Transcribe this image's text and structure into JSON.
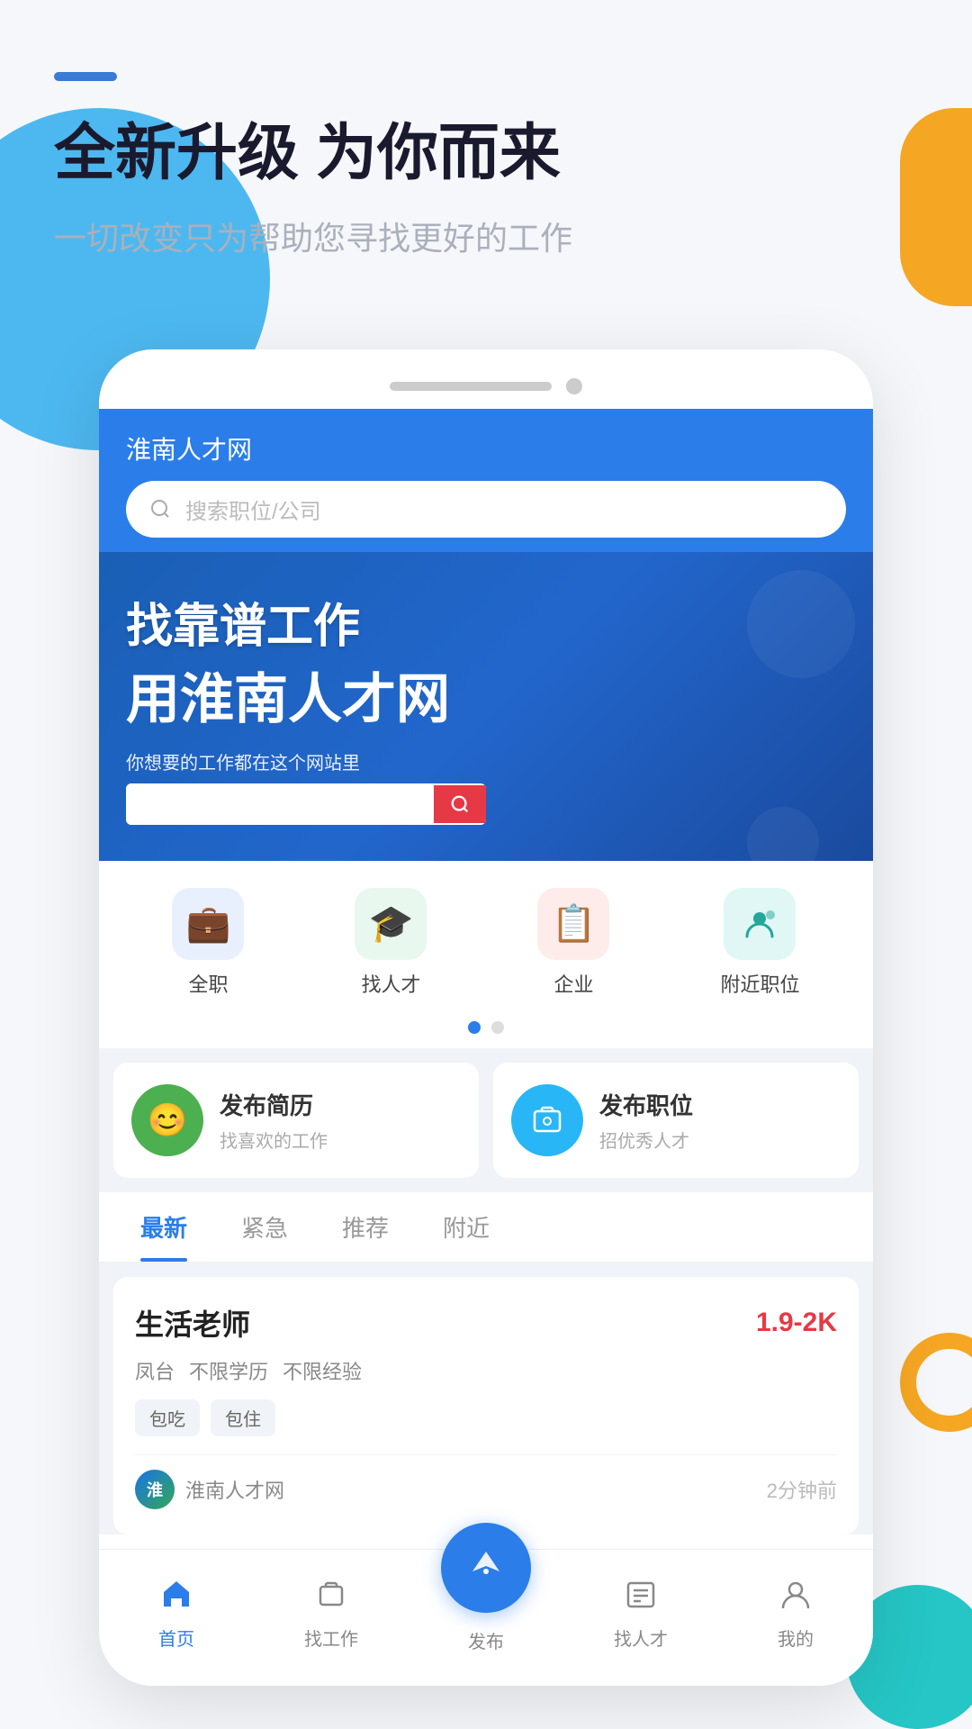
{
  "app": {
    "title": "淮南人才网",
    "tagline_main": "全新升级 为你而来",
    "tagline_sub": "一切改变只为帮助您寻找更好的工作",
    "dash_color": "#3a7bd5"
  },
  "header": {
    "site_name": "淮南人才网",
    "search_placeholder": "搜索职位/公司"
  },
  "banner": {
    "line1": "找靠谱工作",
    "line2": "用淮南人才网",
    "sub": "你想要的工作都在这个网站里",
    "search_placeholder": ""
  },
  "categories": [
    {
      "label": "全职",
      "icon": "💼",
      "color_class": "cat-icon-blue"
    },
    {
      "label": "找人才",
      "icon": "🎓",
      "color_class": "cat-icon-green"
    },
    {
      "label": "企业",
      "icon": "📋",
      "color_class": "cat-icon-red"
    },
    {
      "label": "附近职位",
      "icon": "👤",
      "color_class": "cat-icon-teal"
    }
  ],
  "action_cards": [
    {
      "title": "发布简历",
      "subtitle": "找喜欢的工作",
      "icon": "😊",
      "icon_class": "action-icon-green"
    },
    {
      "title": "发布职位",
      "subtitle": "招优秀人才",
      "icon": "📁",
      "icon_class": "action-icon-blue"
    }
  ],
  "tabs": [
    {
      "label": "最新",
      "active": true
    },
    {
      "label": "紧急",
      "active": false
    },
    {
      "label": "推荐",
      "active": false
    },
    {
      "label": "附近",
      "active": false
    }
  ],
  "job_card": {
    "title": "生活老师",
    "salary": "1.9-2K",
    "tags": [
      "凤台",
      "不限学历",
      "不限经验"
    ],
    "badges": [
      "包吃",
      "包住"
    ],
    "company_name": "淮南人才网",
    "post_time": "2分钟前"
  },
  "bottom_nav": [
    {
      "label": "首页",
      "active": true,
      "icon": "🏠"
    },
    {
      "label": "找工作",
      "active": false,
      "icon": "💼"
    },
    {
      "label": "发布",
      "active": false,
      "icon": "✈",
      "is_fab": true
    },
    {
      "label": "找人才",
      "active": false,
      "icon": "📋"
    },
    {
      "label": "我的",
      "active": false,
      "icon": "👤"
    }
  ]
}
